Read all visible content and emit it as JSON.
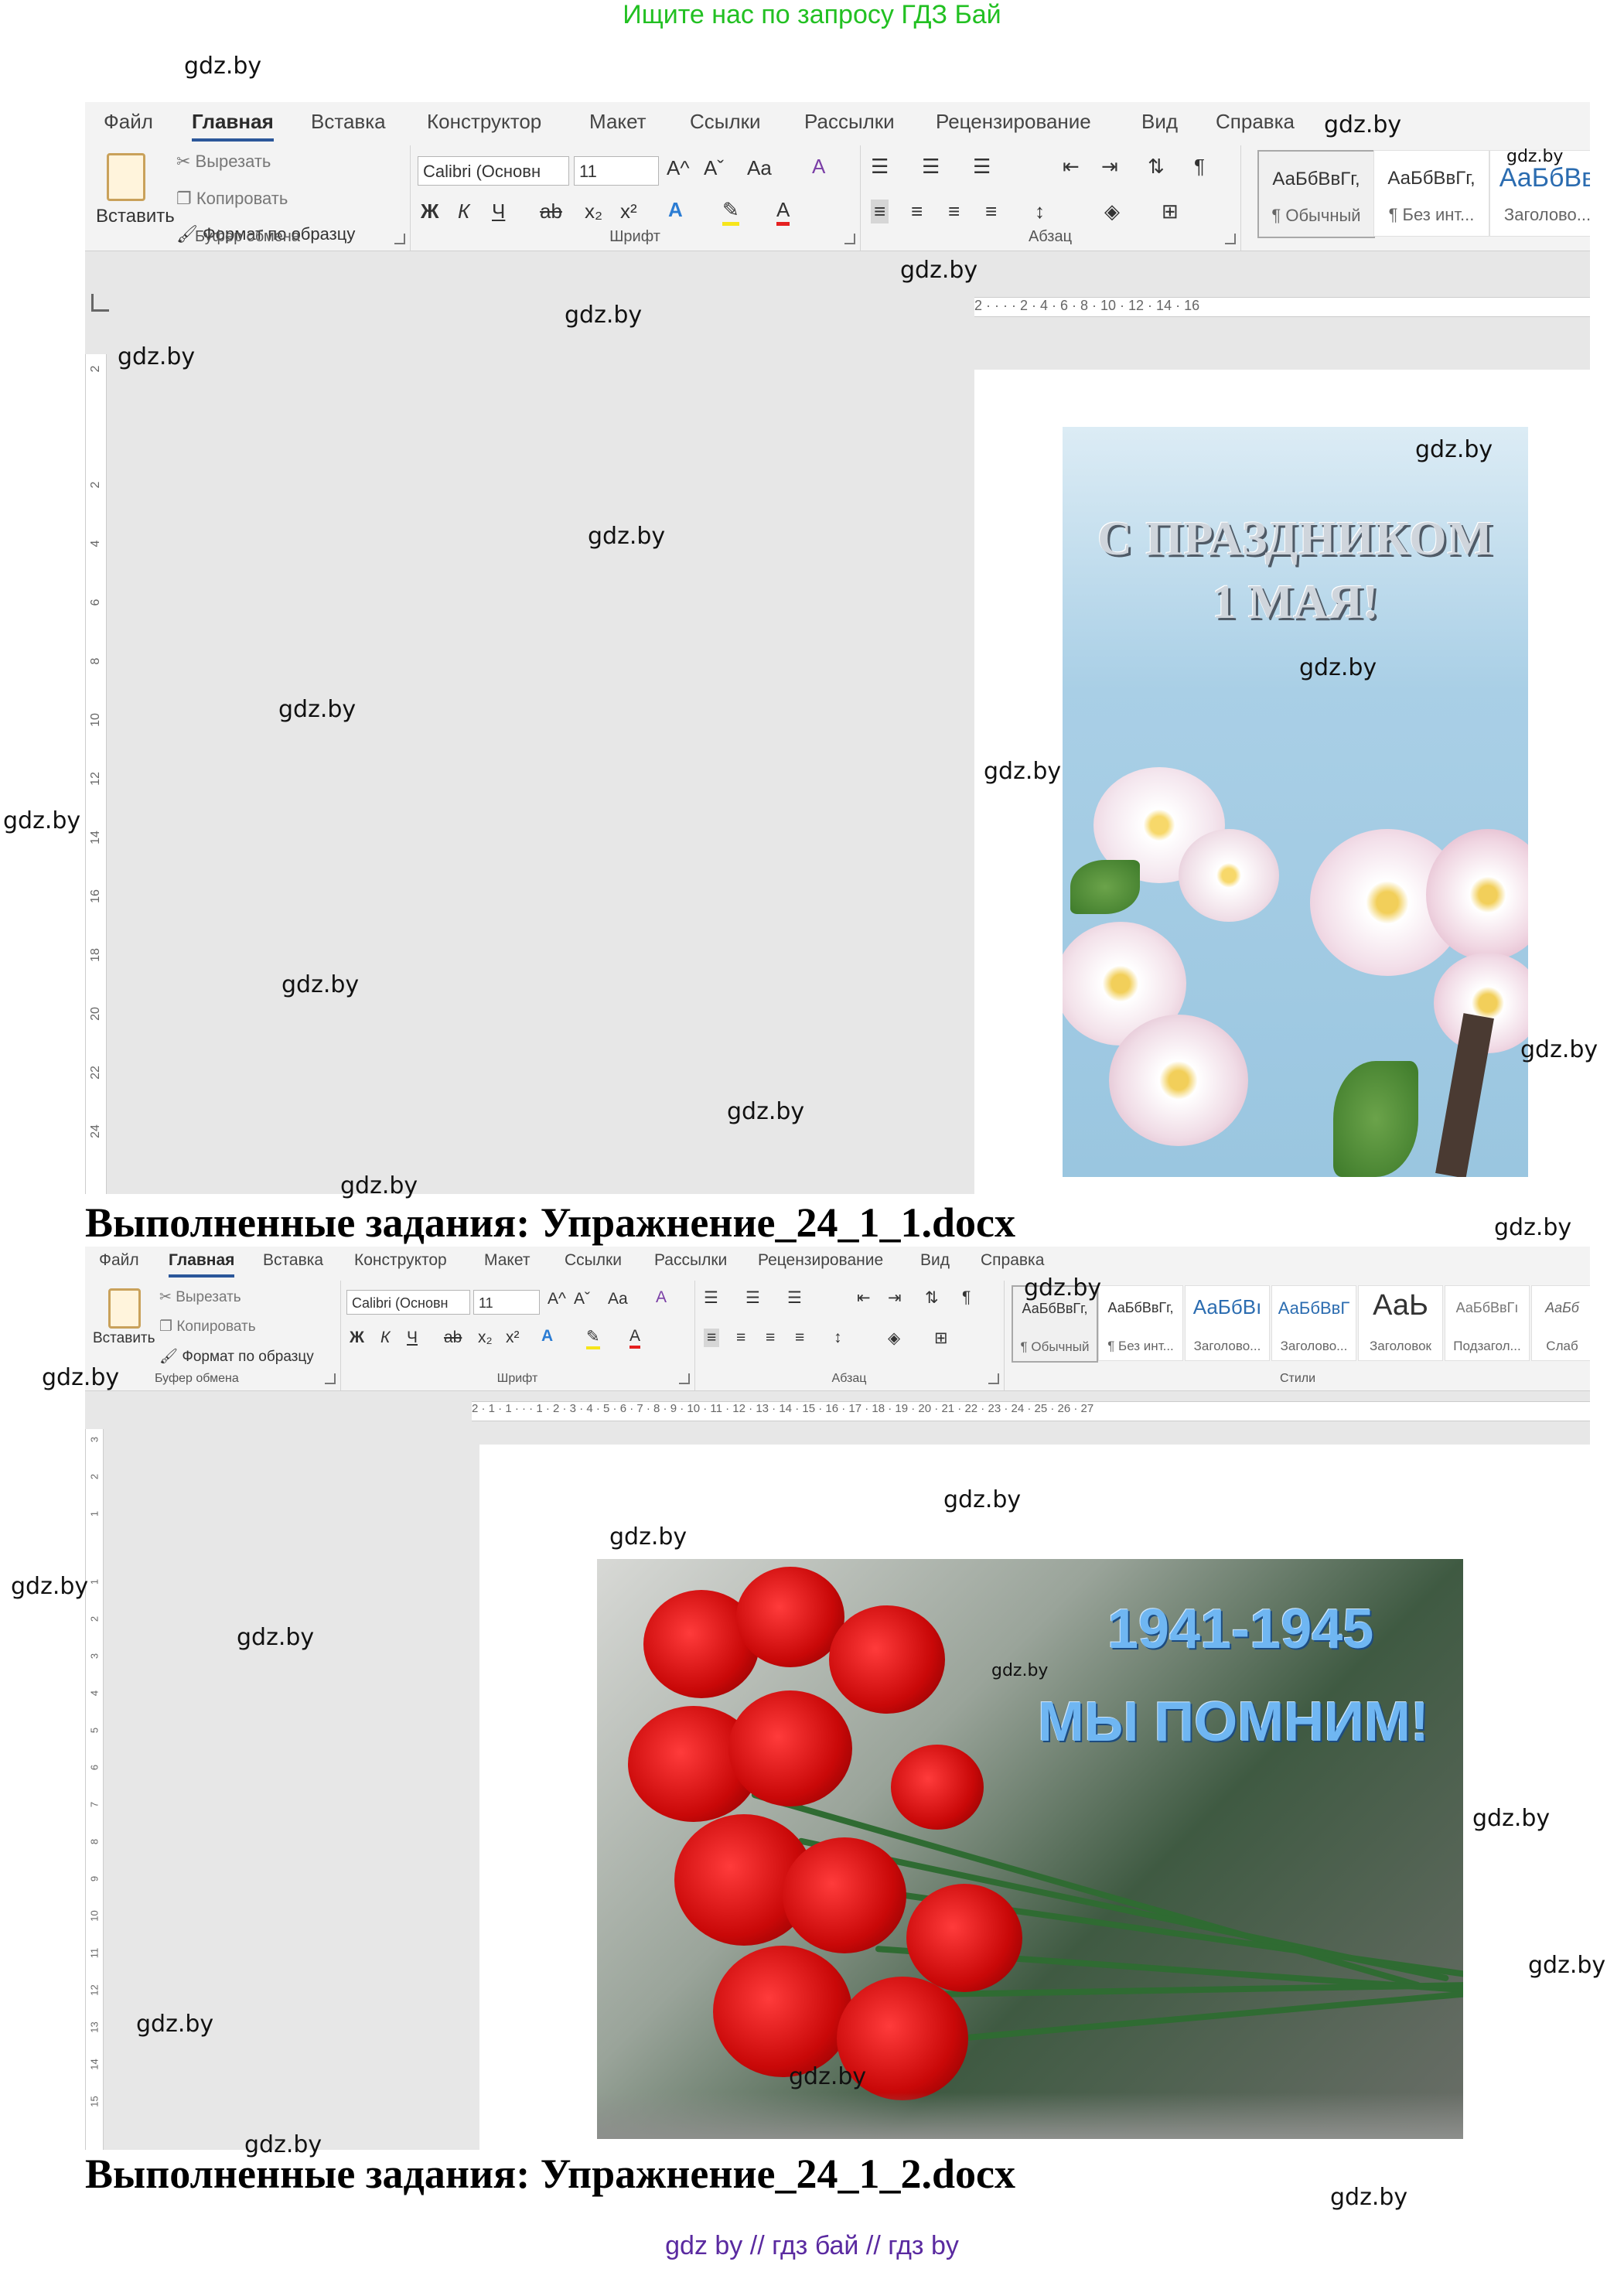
{
  "banner": "Ищите нас по запросу ГДЗ Бай",
  "watermark": "gdz.by",
  "bottom_links": "gdz by  //  гдз бай  //  гдз by",
  "captions": {
    "first": "Выполненные задания: Упражнение_24_1_1.docx",
    "second": "Выполненные задания: Упражнение_24_1_2.docx"
  },
  "ribbon": {
    "tabs": [
      "Файл",
      "Главная",
      "Вставка",
      "Конструктор",
      "Макет",
      "Ссылки",
      "Рассылки",
      "Рецензирование",
      "Вид",
      "Справка"
    ],
    "active_tab": "Главная",
    "clipboard": {
      "paste": "Вставить",
      "cut": "Вырезать",
      "copy": "Копировать",
      "format_painter": "Формат по образцу",
      "label": "Буфер обмена"
    },
    "font": {
      "name": "Calibri (Основн",
      "size": "11",
      "case_button": "Aa",
      "bold": "Ж",
      "italic": "К",
      "underline": "Ч",
      "strike": "ab",
      "subscript": "x₂",
      "superscript": "x²",
      "grow": "A^",
      "shrink": "Aˇ",
      "label": "Шрифт"
    },
    "paragraph": {
      "label": "Абзац"
    },
    "styles": {
      "label": "Стили",
      "items1": [
        {
          "sample": "АаБбВвГг,",
          "name": "¶ Обычный"
        },
        {
          "sample": "АаБбВвГг,",
          "name": "¶ Без инт..."
        },
        {
          "sample": "АаБбВв",
          "name": "Заголово..."
        }
      ],
      "items2": [
        {
          "sample": "АаБбВвГг,",
          "name": "¶ Обычный"
        },
        {
          "sample": "АаБбВвГг,",
          "name": "¶ Без инт..."
        },
        {
          "sample": "АаБбВı",
          "name": "Заголово..."
        },
        {
          "sample": "АаБбВвГ",
          "name": "Заголово..."
        },
        {
          "sample": "АаЬ",
          "name": "Заголовок"
        },
        {
          "sample": "АаБбВвГı",
          "name": "Подзагол..."
        },
        {
          "sample": "АаБб",
          "name": "Слаб"
        }
      ]
    }
  },
  "ruler1": "2 · · · · 2 · 4 · 6 · 8 · 10 · 12 · 14 · 16",
  "ruler2": "2 · 1 · 1 · · · 1 · 2 · 3 · 4 · 5 · 6 · 7 · 8 · 9 · 10 · 11 · 12 · 13 · 14 · 15 · 16 · 17 · 18 · 19 · 20 · 21 · 22 · 23 · 24 · 25 · 26 · 27",
  "vruler1": [
    "2",
    "2",
    "4",
    "6",
    "8",
    "10",
    "12",
    "14",
    "16",
    "18",
    "20",
    "22",
    "24"
  ],
  "vruler2": [
    "3",
    "2",
    "1",
    "1",
    "2",
    "3",
    "4",
    "5",
    "6",
    "7",
    "8",
    "9",
    "10",
    "11",
    "12",
    "13",
    "14",
    "15"
  ],
  "card1": {
    "line1": "С ПРАЗДНИКОМ",
    "line2": "1 МАЯ!"
  },
  "card2": {
    "years": "1941-1945",
    "slogan": "МЫ ПОМНИМ!"
  },
  "colors": {
    "banner": "#22c022",
    "ribbon_bg": "#f3f3f3",
    "workspace": "#e7e7e7",
    "card2_text": "#6fb6f2",
    "links": "#5a2aa0"
  }
}
